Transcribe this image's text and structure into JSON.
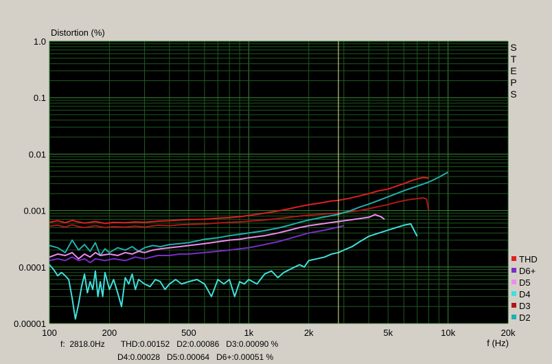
{
  "chart_data": {
    "type": "line",
    "ylabel": "Distortion (%)",
    "xlabel": "f (Hz)",
    "x_scale": "log",
    "y_scale": "log",
    "xlim": [
      100,
      20000
    ],
    "ylim": [
      1e-05,
      1.0
    ],
    "grid": true,
    "legend_position": "right",
    "side_label": "STEPS",
    "x_ticks": [
      {
        "value": 100,
        "label": "100"
      },
      {
        "value": 200,
        "label": "200"
      },
      {
        "value": 500,
        "label": "500"
      },
      {
        "value": 1000,
        "label": "1k"
      },
      {
        "value": 2000,
        "label": "2k"
      },
      {
        "value": 5000,
        "label": "5k"
      },
      {
        "value": 10000,
        "label": "10k"
      },
      {
        "value": 20000,
        "label": "20k"
      }
    ],
    "y_ticks": [
      {
        "value": 1.0,
        "label": "1.0"
      },
      {
        "value": 0.1,
        "label": "0.1"
      },
      {
        "value": 0.01,
        "label": "0.01"
      },
      {
        "value": 0.001,
        "label": "0.001"
      },
      {
        "value": 0.0001,
        "label": "0.0001"
      },
      {
        "value": 1e-05,
        "label": "0.00001"
      }
    ],
    "cursor": {
      "frequency": 2818,
      "readout_line1": "f:  2818.0Hz       THD:0.00152   D2:0.00086   D3:0.00090 %",
      "readout_line2": "D4:0.00028   D5:0.00064   D6+:0.00051 %"
    },
    "legend": [
      {
        "name": "THD",
        "color": "#e02020"
      },
      {
        "name": "D6+",
        "color": "#7a2ec8"
      },
      {
        "name": "D5",
        "color": "#f08cf0"
      },
      {
        "name": "D4",
        "color": "#40e0e0"
      },
      {
        "name": "D3",
        "color": "#b01818"
      },
      {
        "name": "D2",
        "color": "#20b0b0"
      }
    ],
    "series": [
      {
        "name": "THD",
        "color": "#e02020",
        "points": [
          [
            100,
            0.00062
          ],
          [
            110,
            0.00066
          ],
          [
            120,
            0.00061
          ],
          [
            130,
            0.00067
          ],
          [
            140,
            0.00063
          ],
          [
            150,
            0.0006
          ],
          [
            170,
            0.00064
          ],
          [
            190,
            0.00059
          ],
          [
            210,
            0.00062
          ],
          [
            240,
            0.00061
          ],
          [
            270,
            0.00063
          ],
          [
            300,
            0.00062
          ],
          [
            350,
            0.00065
          ],
          [
            400,
            0.00066
          ],
          [
            450,
            0.00068
          ],
          [
            500,
            0.00069
          ],
          [
            600,
            0.0007
          ],
          [
            700,
            0.00073
          ],
          [
            800,
            0.00075
          ],
          [
            900,
            0.00078
          ],
          [
            1000,
            0.00082
          ],
          [
            1200,
            0.0009
          ],
          [
            1400,
            0.00098
          ],
          [
            1600,
            0.00108
          ],
          [
            1800,
            0.00118
          ],
          [
            2000,
            0.00127
          ],
          [
            2300,
            0.00137
          ],
          [
            2600,
            0.00148
          ],
          [
            2818,
            0.00152
          ],
          [
            3200,
            0.00165
          ],
          [
            3600,
            0.00182
          ],
          [
            4000,
            0.002
          ],
          [
            4500,
            0.00225
          ],
          [
            5000,
            0.0024
          ],
          [
            5500,
            0.0027
          ],
          [
            6000,
            0.003
          ],
          [
            6500,
            0.00335
          ],
          [
            7000,
            0.00365
          ],
          [
            7500,
            0.00385
          ],
          [
            8000,
            0.00375
          ]
        ]
      },
      {
        "name": "D3",
        "color": "#b01818",
        "points": [
          [
            100,
            0.00053
          ],
          [
            110,
            0.00055
          ],
          [
            120,
            0.00051
          ],
          [
            130,
            0.00056
          ],
          [
            140,
            0.00052
          ],
          [
            150,
            0.0005
          ],
          [
            170,
            0.00054
          ],
          [
            190,
            0.0005
          ],
          [
            210,
            0.00052
          ],
          [
            240,
            0.00051
          ],
          [
            270,
            0.00053
          ],
          [
            300,
            0.00051
          ],
          [
            350,
            0.00055
          ],
          [
            400,
            0.00054
          ],
          [
            450,
            0.00056
          ],
          [
            500,
            0.00057
          ],
          [
            600,
            0.00058
          ],
          [
            700,
            0.0006
          ],
          [
            800,
            0.00062
          ],
          [
            900,
            0.00063
          ],
          [
            1000,
            0.00065
          ],
          [
            1200,
            0.00068
          ],
          [
            1400,
            0.00072
          ],
          [
            1600,
            0.00076
          ],
          [
            1800,
            0.0008
          ],
          [
            2000,
            0.00083
          ],
          [
            2400,
            0.00087
          ],
          [
            2818,
            0.0009
          ],
          [
            3200,
            0.00095
          ],
          [
            3600,
            0.001
          ],
          [
            4000,
            0.00108
          ],
          [
            4500,
            0.00118
          ],
          [
            5000,
            0.00128
          ],
          [
            5500,
            0.0014
          ],
          [
            6000,
            0.0015
          ],
          [
            6500,
            0.00158
          ],
          [
            7000,
            0.00163
          ],
          [
            7500,
            0.00168
          ],
          [
            7800,
            0.0016
          ],
          [
            8000,
            0.001
          ]
        ]
      },
      {
        "name": "D2",
        "color": "#20b0b0",
        "points": [
          [
            100,
            0.00024
          ],
          [
            110,
            0.00022
          ],
          [
            120,
            0.00018
          ],
          [
            130,
            0.0003
          ],
          [
            140,
            0.0002
          ],
          [
            150,
            0.00025
          ],
          [
            160,
            0.00019
          ],
          [
            170,
            0.00027
          ],
          [
            180,
            0.00016
          ],
          [
            190,
            0.00021
          ],
          [
            200,
            0.00018
          ],
          [
            220,
            0.00022
          ],
          [
            240,
            0.0002
          ],
          [
            260,
            0.00023
          ],
          [
            280,
            0.00019
          ],
          [
            300,
            0.00022
          ],
          [
            330,
            0.00024
          ],
          [
            360,
            0.00023
          ],
          [
            400,
            0.00025
          ],
          [
            450,
            0.00026
          ],
          [
            500,
            0.00027
          ],
          [
            550,
            0.00029
          ],
          [
            600,
            0.00031
          ],
          [
            700,
            0.00033
          ],
          [
            800,
            0.00036
          ],
          [
            900,
            0.00038
          ],
          [
            1000,
            0.0004
          ],
          [
            1200,
            0.00044
          ],
          [
            1400,
            0.00049
          ],
          [
            1600,
            0.00055
          ],
          [
            1800,
            0.00062
          ],
          [
            2000,
            0.00068
          ],
          [
            2400,
            0.00077
          ],
          [
            2818,
            0.00086
          ],
          [
            3200,
            0.00098
          ],
          [
            3600,
            0.00115
          ],
          [
            4000,
            0.0013
          ],
          [
            4500,
            0.00152
          ],
          [
            5000,
            0.00175
          ],
          [
            5500,
            0.002
          ],
          [
            6000,
            0.00225
          ],
          [
            7000,
            0.0027
          ],
          [
            8000,
            0.0032
          ],
          [
            9000,
            0.0039
          ],
          [
            10000,
            0.0048
          ]
        ]
      },
      {
        "name": "D5",
        "color": "#f08cf0",
        "points": [
          [
            100,
            0.00015
          ],
          [
            110,
            0.00017
          ],
          [
            120,
            0.00016
          ],
          [
            130,
            0.00018
          ],
          [
            140,
            0.00014
          ],
          [
            150,
            0.00017
          ],
          [
            160,
            0.00015
          ],
          [
            170,
            0.00018
          ],
          [
            180,
            0.00016
          ],
          [
            200,
            0.00017
          ],
          [
            220,
            0.00016
          ],
          [
            240,
            0.00018
          ],
          [
            260,
            0.00017
          ],
          [
            280,
            0.00019
          ],
          [
            300,
            0.00018
          ],
          [
            330,
            0.0002
          ],
          [
            360,
            0.00021
          ],
          [
            400,
            0.00022
          ],
          [
            450,
            0.00023
          ],
          [
            500,
            0.00024
          ],
          [
            600,
            0.00026
          ],
          [
            700,
            0.00028
          ],
          [
            800,
            0.0003
          ],
          [
            900,
            0.00031
          ],
          [
            1000,
            0.00033
          ],
          [
            1200,
            0.00036
          ],
          [
            1400,
            0.0004
          ],
          [
            1600,
            0.00045
          ],
          [
            1800,
            0.0005
          ],
          [
            2000,
            0.00054
          ],
          [
            2400,
            0.00059
          ],
          [
            2818,
            0.00064
          ],
          [
            3200,
            0.00068
          ],
          [
            3600,
            0.00072
          ],
          [
            4000,
            0.00076
          ],
          [
            4300,
            0.00085
          ],
          [
            4600,
            0.00078
          ],
          [
            4800,
            0.0007
          ]
        ]
      },
      {
        "name": "D6+",
        "color": "#7a2ec8",
        "points": [
          [
            100,
            0.00013
          ],
          [
            110,
            0.00014
          ],
          [
            120,
            0.00013
          ],
          [
            130,
            0.00015
          ],
          [
            140,
            0.00013
          ],
          [
            150,
            0.00014
          ],
          [
            160,
            0.00012
          ],
          [
            170,
            0.00014
          ],
          [
            190,
            0.00013
          ],
          [
            210,
            0.00014
          ],
          [
            240,
            0.00013
          ],
          [
            270,
            0.00015
          ],
          [
            300,
            0.00014
          ],
          [
            350,
            0.00016
          ],
          [
            400,
            0.00016
          ],
          [
            450,
            0.00017
          ],
          [
            500,
            0.00017
          ],
          [
            600,
            0.00018
          ],
          [
            700,
            0.00019
          ],
          [
            800,
            0.0002
          ],
          [
            900,
            0.00021
          ],
          [
            1000,
            0.00022
          ],
          [
            1200,
            0.00025
          ],
          [
            1400,
            0.00028
          ],
          [
            1600,
            0.00032
          ],
          [
            1800,
            0.00036
          ],
          [
            2000,
            0.0004
          ],
          [
            2400,
            0.00045
          ],
          [
            2818,
            0.00051
          ],
          [
            3000,
            0.00054
          ]
        ]
      },
      {
        "name": "D4",
        "color": "#40e0e0",
        "points": [
          [
            100,
            0.00011
          ],
          [
            105,
            9e-05
          ],
          [
            110,
            7e-05
          ],
          [
            115,
            8e-05
          ],
          [
            120,
            7e-05
          ],
          [
            125,
            6e-05
          ],
          [
            130,
            2.8e-05
          ],
          [
            135,
            1.2e-05
          ],
          [
            140,
            2.2e-05
          ],
          [
            145,
            4.5e-05
          ],
          [
            150,
            7.5e-05
          ],
          [
            155,
            3.5e-05
          ],
          [
            160,
            5.5e-05
          ],
          [
            165,
            4e-05
          ],
          [
            170,
            8.5e-05
          ],
          [
            175,
            3e-05
          ],
          [
            180,
            5.5e-05
          ],
          [
            185,
            3e-05
          ],
          [
            190,
            8e-05
          ],
          [
            200,
            4e-05
          ],
          [
            210,
            6e-05
          ],
          [
            220,
            3.5e-05
          ],
          [
            230,
            2e-05
          ],
          [
            240,
            6.5e-05
          ],
          [
            250,
            5e-05
          ],
          [
            260,
            7.5e-05
          ],
          [
            270,
            4e-05
          ],
          [
            280,
            6e-05
          ],
          [
            300,
            5e-05
          ],
          [
            320,
            4.5e-05
          ],
          [
            340,
            6e-05
          ],
          [
            360,
            5.5e-05
          ],
          [
            380,
            4e-05
          ],
          [
            400,
            5e-05
          ],
          [
            430,
            6e-05
          ],
          [
            460,
            5e-05
          ],
          [
            500,
            5.5e-05
          ],
          [
            550,
            6e-05
          ],
          [
            600,
            5e-05
          ],
          [
            650,
            3e-05
          ],
          [
            700,
            6e-05
          ],
          [
            750,
            5e-05
          ],
          [
            800,
            6e-05
          ],
          [
            850,
            3e-05
          ],
          [
            900,
            5.5e-05
          ],
          [
            950,
            5e-05
          ],
          [
            1000,
            6e-05
          ],
          [
            1100,
            5e-05
          ],
          [
            1200,
            7.5e-05
          ],
          [
            1300,
            8.5e-05
          ],
          [
            1400,
            6.5e-05
          ],
          [
            1500,
            8e-05
          ],
          [
            1600,
            9e-05
          ],
          [
            1700,
            0.0001
          ],
          [
            1800,
            0.00011
          ],
          [
            1900,
            0.0001
          ],
          [
            2000,
            0.00013
          ],
          [
            2200,
            0.00014
          ],
          [
            2400,
            0.00015
          ],
          [
            2600,
            0.00017
          ],
          [
            2818,
            0.00018
          ],
          [
            3000,
            0.0002
          ],
          [
            3300,
            0.00023
          ],
          [
            3600,
            0.00028
          ],
          [
            4000,
            0.00035
          ],
          [
            4500,
            0.0004
          ],
          [
            5000,
            0.00045
          ],
          [
            5500,
            0.0005
          ],
          [
            6000,
            0.00055
          ],
          [
            6500,
            0.00058
          ],
          [
            7000,
            0.00035
          ]
        ]
      }
    ]
  }
}
